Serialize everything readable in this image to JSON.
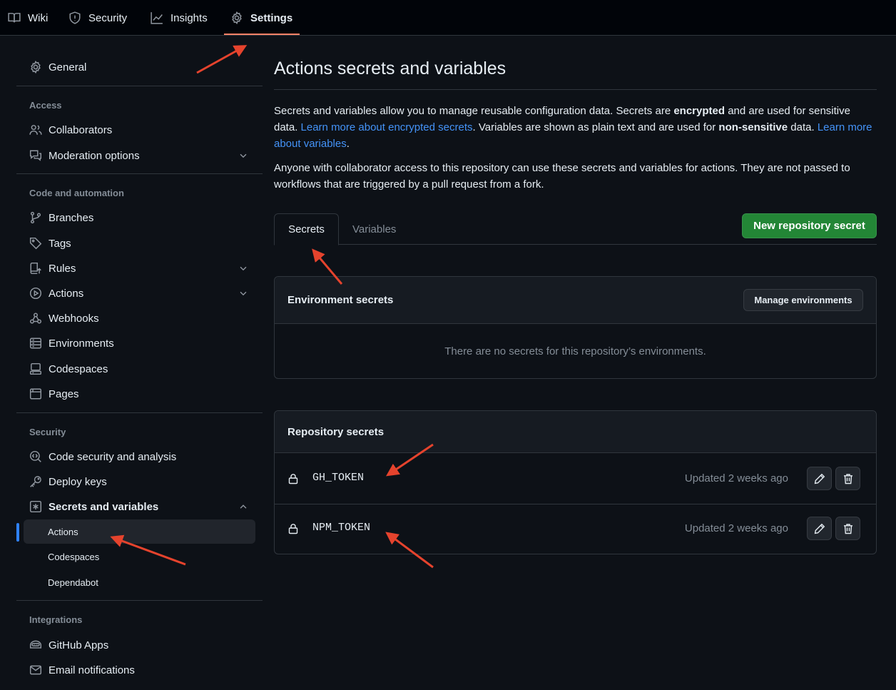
{
  "topnav": {
    "tabs": [
      {
        "label": "Wiki",
        "icon": "book-icon"
      },
      {
        "label": "Security",
        "icon": "shield-icon"
      },
      {
        "label": "Insights",
        "icon": "graph-icon"
      },
      {
        "label": "Settings",
        "icon": "gear-icon",
        "active": true
      }
    ]
  },
  "sidebar": {
    "general": "General",
    "sections": {
      "access": "Access",
      "code_automation": "Code and automation",
      "security": "Security",
      "integrations": "Integrations"
    },
    "items": {
      "collaborators": "Collaborators",
      "moderation": "Moderation options",
      "branches": "Branches",
      "tags": "Tags",
      "rules": "Rules",
      "actions": "Actions",
      "webhooks": "Webhooks",
      "environments": "Environments",
      "codespaces": "Codespaces",
      "pages": "Pages",
      "code_security": "Code security and analysis",
      "deploy_keys": "Deploy keys",
      "secrets_variables": "Secrets and variables",
      "github_apps": "GitHub Apps",
      "email_notifications": "Email notifications"
    },
    "sub_items": {
      "actions": "Actions",
      "codespaces": "Codespaces",
      "dependabot": "Dependabot"
    },
    "active_item": "Actions"
  },
  "main": {
    "title": "Actions secrets and variables",
    "intro": {
      "p1_a": "Secrets and variables allow you to manage reusable configuration data. Secrets are ",
      "p1_b": "encrypted",
      "p1_c": " and are used for sensitive data. ",
      "p1_link1": "Learn more about encrypted secrets",
      "p1_d": ". Variables are shown as plain text and are used for ",
      "p1_e": "non-sensitive",
      "p1_f": " data. ",
      "p1_link2": "Learn more about variables",
      "p1_g": ".",
      "p2": "Anyone with collaborator access to this repository can use these secrets and variables for actions. They are not passed to workflows that are triggered by a pull request from a fork."
    },
    "tabs": {
      "secrets": "Secrets",
      "variables": "Variables"
    },
    "new_secret_button": "New repository secret",
    "env_secrets": {
      "title": "Environment secrets",
      "manage_button": "Manage environments",
      "empty": "There are no secrets for this repository’s environments."
    },
    "repo_secrets": {
      "title": "Repository secrets",
      "rows": [
        {
          "name": "GH_TOKEN",
          "updated": "Updated 2 weeks ago"
        },
        {
          "name": "NPM_TOKEN",
          "updated": "Updated 2 weeks ago"
        }
      ]
    }
  },
  "colors": {
    "bg": "#0d1117",
    "nav_bg": "#010409",
    "accent_underline": "#f78166",
    "link": "#4493f8",
    "primary_button": "#238636",
    "active_indicator": "#2f81f7",
    "annotation_arrow": "#e5432d"
  }
}
